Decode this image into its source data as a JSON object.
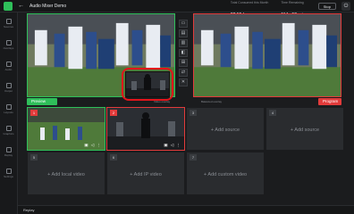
{
  "header": {
    "back_icon": "arrow-left-icon",
    "title": "Audio Mixer Demo",
    "stats": [
      {
        "label": "Total Consumed this Month",
        "value": "22:55 hrs"
      },
      {
        "label": "Time Remaining",
        "value": "114 : 52 mins"
      }
    ],
    "stop_label": "Stop",
    "power_icon": "power-icon"
  },
  "sidebar": {
    "items": [
      {
        "icon": "sources-icon",
        "label": "Sources"
      },
      {
        "icon": "overlays-icon",
        "label": "Overlays"
      },
      {
        "icon": "audio-icon",
        "label": "Audio"
      },
      {
        "icon": "output-icon",
        "label": "Output"
      },
      {
        "icon": "layouts-icon",
        "label": "Layouts"
      },
      {
        "icon": "graphics-icon",
        "label": "Graphics"
      },
      {
        "icon": "replay-icon",
        "label": "Replay"
      },
      {
        "icon": "settings-icon",
        "label": "Settings"
      }
    ]
  },
  "preview": {
    "label": "Preview",
    "caption": "Video overlay"
  },
  "program": {
    "label": "Program",
    "caption": "Balanced overlay"
  },
  "sources": [
    {
      "num": "1",
      "type": "video"
    },
    {
      "num": "2",
      "type": "video"
    },
    {
      "num": "3",
      "add_label": "+ Add source"
    },
    {
      "num": "4",
      "add_label": "+ Add source"
    },
    {
      "num": "5",
      "add_label": "+ Add local video"
    },
    {
      "num": "6",
      "add_label": "+ Add IP video"
    },
    {
      "num": "7",
      "add_label": "+ Add custom video"
    }
  ],
  "footer": {
    "replay_label": "Replay"
  }
}
